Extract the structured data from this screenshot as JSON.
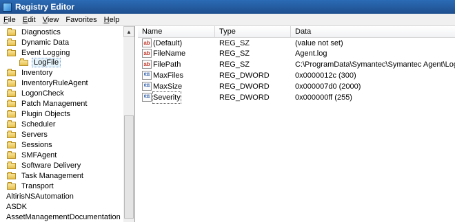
{
  "window": {
    "title": "Registry Editor"
  },
  "menu": [
    {
      "underline": "F",
      "rest": "ile"
    },
    {
      "underline": "E",
      "rest": "dit"
    },
    {
      "underline": "V",
      "rest": "iew"
    },
    {
      "underline": "",
      "rest": "Favorites"
    },
    {
      "underline": "H",
      "rest": "elp"
    }
  ],
  "tree": {
    "items": [
      {
        "label": "Diagnostics",
        "folder": true
      },
      {
        "label": "Dynamic Data",
        "folder": true
      },
      {
        "label": "Event Logging",
        "folder": true
      },
      {
        "label": "LogFile",
        "folder": true,
        "selected": true
      },
      {
        "label": "Inventory",
        "folder": true
      },
      {
        "label": "InventoryRuleAgent",
        "folder": true
      },
      {
        "label": "LogonCheck",
        "folder": true
      },
      {
        "label": "Patch Management",
        "folder": true
      },
      {
        "label": "Plugin Objects",
        "folder": true
      },
      {
        "label": "Scheduler",
        "folder": true
      },
      {
        "label": "Servers",
        "folder": true
      },
      {
        "label": "Sessions",
        "folder": true
      },
      {
        "label": "SMFAgent",
        "folder": true
      },
      {
        "label": "Software Delivery",
        "folder": true
      },
      {
        "label": "Task Management",
        "folder": true
      },
      {
        "label": "Transport",
        "folder": true
      },
      {
        "label": "AltirisNSAutomation",
        "folder": false
      },
      {
        "label": "ASDK",
        "folder": false
      },
      {
        "label": "AssetManagementDocumentation",
        "folder": false
      }
    ]
  },
  "list": {
    "columns": [
      "Name",
      "Type",
      "Data"
    ],
    "rows": [
      {
        "icon": "ab",
        "name": "(Default)",
        "type": "REG_SZ",
        "data": "(value not set)"
      },
      {
        "icon": "ab",
        "name": "FileName",
        "type": "REG_SZ",
        "data": "Agent.log"
      },
      {
        "icon": "ab",
        "name": "FilePath",
        "type": "REG_SZ",
        "data": "C:\\ProgramData\\Symantec\\Symantec Agent\\Logs"
      },
      {
        "icon": "011",
        "name": "MaxFiles",
        "type": "REG_DWORD",
        "data": "0x0000012c (300)"
      },
      {
        "icon": "011",
        "name": "MaxSize",
        "type": "REG_DWORD",
        "data": "0x000007d0 (2000)"
      },
      {
        "icon": "011",
        "name": "Severity",
        "type": "REG_DWORD",
        "data": "0x000000ff (255)"
      }
    ]
  }
}
